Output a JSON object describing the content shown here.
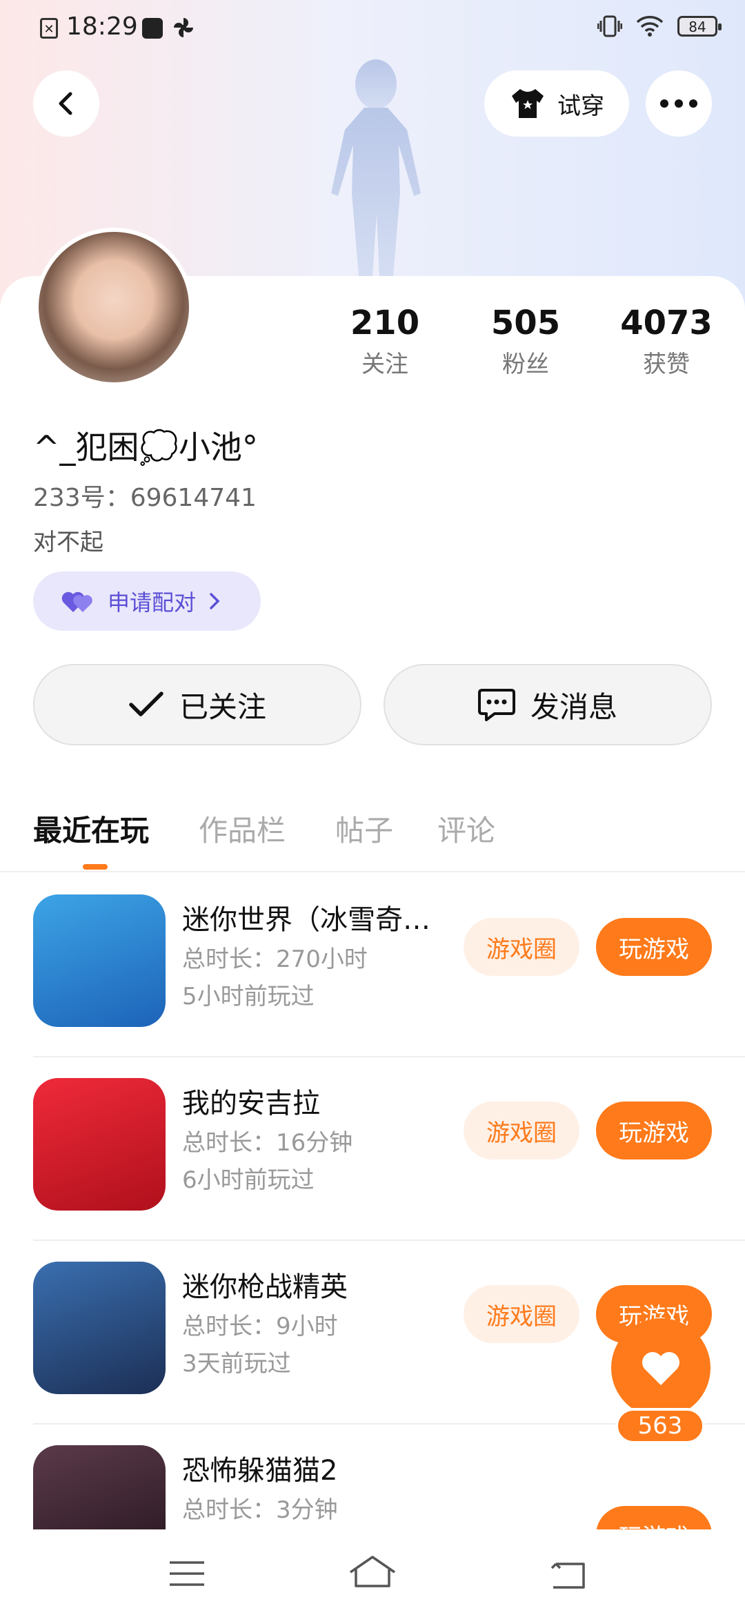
{
  "status": {
    "time": "18:29",
    "battery": "84"
  },
  "header": {
    "tryon_label": "试穿"
  },
  "profile": {
    "stats": [
      {
        "num": "210",
        "label": "关注"
      },
      {
        "num": "505",
        "label": "粉丝"
      },
      {
        "num": "4073",
        "label": "获赞"
      }
    ],
    "nickname": "^_犯困💭小池°",
    "uid": "233号：69614741",
    "bio": "对不起",
    "pair_label": "申请配对",
    "follow_label": "已关注",
    "message_label": "发消息"
  },
  "tabs": [
    "最近在玩",
    "作品栏",
    "帖子",
    "评论"
  ],
  "games": [
    {
      "title": "迷你世界（冰雪奇…",
      "duration": "总时长：270小时",
      "last": "5小时前玩过",
      "icon": "mini-world-icon",
      "colors": [
        "#3da4e6",
        "#1d63b8"
      ]
    },
    {
      "title": "我的安吉拉",
      "duration": "总时长：16分钟",
      "last": "6小时前玩过",
      "icon": "angela-icon",
      "colors": [
        "#ef2a3a",
        "#b0101c"
      ]
    },
    {
      "title": "迷你枪战精英",
      "duration": "总时长：9小时",
      "last": "3天前玩过",
      "icon": "mini-gun-icon",
      "colors": [
        "#3a6fb0",
        "#1c2f55"
      ]
    },
    {
      "title": "恐怖躲猫猫2",
      "duration": "总时长：3分钟",
      "last": "",
      "icon": "horror-hide-icon",
      "colors": [
        "#5b3a4a",
        "#22131b"
      ]
    }
  ],
  "game_buttons": {
    "circle": "游戏圈",
    "play": "玩游戏"
  },
  "like_count": "563"
}
